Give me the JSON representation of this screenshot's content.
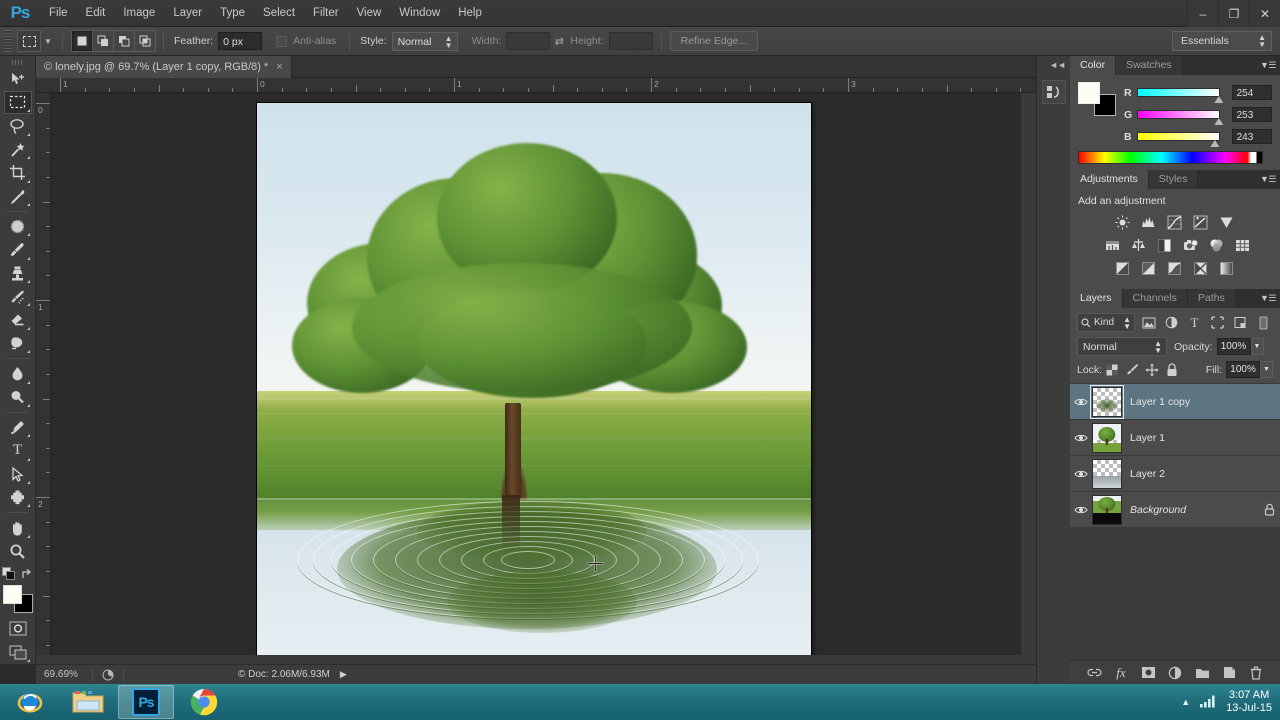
{
  "app": {
    "name": "Adobe Photoshop",
    "logo_text": "Ps"
  },
  "menubar": {
    "items": [
      {
        "label": "File"
      },
      {
        "label": "Edit"
      },
      {
        "label": "Image"
      },
      {
        "label": "Layer"
      },
      {
        "label": "Type"
      },
      {
        "label": "Select"
      },
      {
        "label": "Filter"
      },
      {
        "label": "View"
      },
      {
        "label": "Window"
      },
      {
        "label": "Help"
      }
    ],
    "window_controls": [
      {
        "name": "minimize",
        "glyph": "–"
      },
      {
        "name": "restore",
        "glyph": "❐"
      },
      {
        "name": "close",
        "glyph": "✕"
      }
    ]
  },
  "options_bar": {
    "tool_preset_icon": "rectangular-marquee-icon",
    "selection_modes": [
      "new-selection",
      "add-to-selection",
      "subtract-from-selection",
      "intersect-selection"
    ],
    "feather_label": "Feather:",
    "feather_value": "0 px",
    "antialias_label": "Anti-alias",
    "style_label": "Style:",
    "style_value": "Normal",
    "width_label": "Width:",
    "width_value": "",
    "height_label": "Height:",
    "height_value": "",
    "refine_edge_label": "Refine Edge...",
    "workspace_value": "Essentials"
  },
  "toolbar": {
    "tools": [
      {
        "name": "move-tool",
        "active": false
      },
      {
        "name": "rectangular-marquee-tool",
        "active": true
      },
      {
        "name": "lasso-tool",
        "active": false
      },
      {
        "name": "magic-wand-tool",
        "active": false
      },
      {
        "name": "crop-tool",
        "active": false
      },
      {
        "name": "eyedropper-tool",
        "active": false
      },
      {
        "name": "spot-healing-brush-tool",
        "active": false
      },
      {
        "name": "brush-tool",
        "active": false
      },
      {
        "name": "clone-stamp-tool",
        "active": false
      },
      {
        "name": "history-brush-tool",
        "active": false
      },
      {
        "name": "eraser-tool",
        "active": false
      },
      {
        "name": "gradient-tool",
        "active": false
      },
      {
        "name": "blur-tool",
        "active": false
      },
      {
        "name": "dodge-tool",
        "active": false
      },
      {
        "name": "pen-tool",
        "active": false
      },
      {
        "name": "horizontal-type-tool",
        "active": false,
        "glyph": "T"
      },
      {
        "name": "path-selection-tool",
        "active": false
      },
      {
        "name": "custom-shape-tool",
        "active": false
      },
      {
        "name": "hand-tool",
        "active": false
      },
      {
        "name": "zoom-tool",
        "active": false
      }
    ],
    "foreground_color": "#fefdf3",
    "background_color": "#000000",
    "quick_mask_name": "quick-mask-mode",
    "screen_mode_name": "screen-mode"
  },
  "document": {
    "tab_title": "© lonely.jpg @ 69.7% (Layer 1 copy, RGB/8) *",
    "close_glyph": "×",
    "ruler_h_labels": [
      "1",
      "0",
      "1",
      "2",
      "3"
    ],
    "ruler_v_labels": [
      "0",
      "1",
      "2"
    ]
  },
  "status_bar": {
    "zoom": "69.69%",
    "doc_info": "© Doc: 2.06M/6.93M",
    "play_glyph": "▶"
  },
  "color_panel": {
    "tabs": [
      {
        "label": "Color",
        "active": true
      },
      {
        "label": "Swatches",
        "active": false
      }
    ],
    "channels": [
      {
        "label": "R",
        "value": "254"
      },
      {
        "label": "G",
        "value": "253"
      },
      {
        "label": "B",
        "value": "243"
      }
    ],
    "foreground": "#fefdf3",
    "background": "#000000"
  },
  "adjustments_panel": {
    "tabs": [
      {
        "label": "Adjustments",
        "active": true
      },
      {
        "label": "Styles",
        "active": false
      }
    ],
    "title": "Add an adjustment",
    "rows": [
      [
        "brightness-contrast-icon",
        "levels-icon",
        "curves-icon",
        "exposure-icon",
        "vibrance-icon"
      ],
      [
        "hue-saturation-icon",
        "color-balance-icon",
        "black-white-icon",
        "photo-filter-icon",
        "channel-mixer-icon",
        "color-lookup-icon"
      ],
      [
        "invert-icon",
        "posterize-icon",
        "threshold-icon",
        "selective-color-icon",
        "gradient-map-icon"
      ]
    ]
  },
  "layers_panel": {
    "tabs": [
      {
        "label": "Layers",
        "active": true
      },
      {
        "label": "Channels",
        "active": false
      },
      {
        "label": "Paths",
        "active": false
      }
    ],
    "filter_kind": "Kind",
    "filter_icons": [
      "filter-pixel-icon",
      "filter-adjustment-icon",
      "filter-type-icon",
      "filter-shape-icon",
      "filter-smart-object-icon",
      "filter-toggle-icon"
    ],
    "blend_mode": "Normal",
    "opacity_label": "Opacity:",
    "opacity_value": "100%",
    "lock_label": "Lock:",
    "lock_icons": [
      "lock-transparent-pixels-icon",
      "lock-image-pixels-icon",
      "lock-position-icon",
      "lock-all-icon"
    ],
    "fill_label": "Fill:",
    "fill_value": "100%",
    "layers": [
      {
        "name": "Layer 1 copy",
        "selected": true,
        "locked": false,
        "italic": false,
        "thumb": "ripple-transparent"
      },
      {
        "name": "Layer 1",
        "selected": false,
        "locked": false,
        "italic": false,
        "thumb": "tree-transparent"
      },
      {
        "name": "Layer 2",
        "selected": false,
        "locked": false,
        "italic": false,
        "thumb": "gray-transparent"
      },
      {
        "name": "Background",
        "selected": false,
        "locked": true,
        "italic": true,
        "thumb": "tree-black"
      }
    ],
    "footer_icons": [
      "link-layers-icon",
      "layer-style-fx-icon",
      "add-layer-mask-icon",
      "new-adjustment-layer-icon",
      "new-group-icon",
      "new-layer-icon",
      "delete-layer-icon"
    ]
  },
  "taskbar": {
    "items": [
      {
        "name": "internet-explorer",
        "active": false
      },
      {
        "name": "file-explorer",
        "active": false
      },
      {
        "name": "photoshop",
        "active": true,
        "label": "Ps"
      },
      {
        "name": "google-chrome",
        "active": false
      }
    ],
    "tray": {
      "show_hidden_glyph": "▲",
      "network_icon": "network-signal-icon",
      "time": "3:07 AM",
      "date": "13-Jul-15"
    }
  }
}
